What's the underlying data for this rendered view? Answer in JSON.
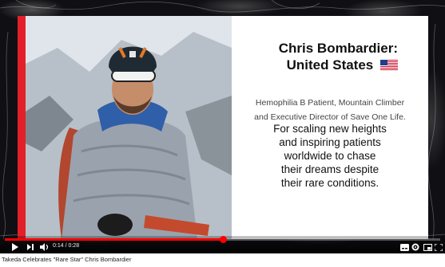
{
  "video": {
    "name_line1": "Chris Bombardier:",
    "name_line2": "United States",
    "subtitle_line1": "Hemophilia B Patient, Mountain Climber",
    "subtitle_line2": "and Executive Director of Save One Life.",
    "quote_lines": [
      "For scaling new heights",
      "and inspiring patients",
      "worldwide to chase",
      "their dreams despite",
      "their rare conditions."
    ],
    "accent_color": "#e3202a"
  },
  "player": {
    "time_display": "0:14 / 0:28",
    "progress_fraction": 0.5,
    "progress_color": "#ff0000",
    "icons": [
      "play-icon",
      "next-icon",
      "volume-icon",
      "subtitles-icon",
      "settings-icon",
      "miniplayer-icon",
      "theater-icon",
      "fullscreen-icon"
    ]
  },
  "page": {
    "video_title": "Takeda Celebrates \"Rare Star\" Chris Bombardier"
  }
}
